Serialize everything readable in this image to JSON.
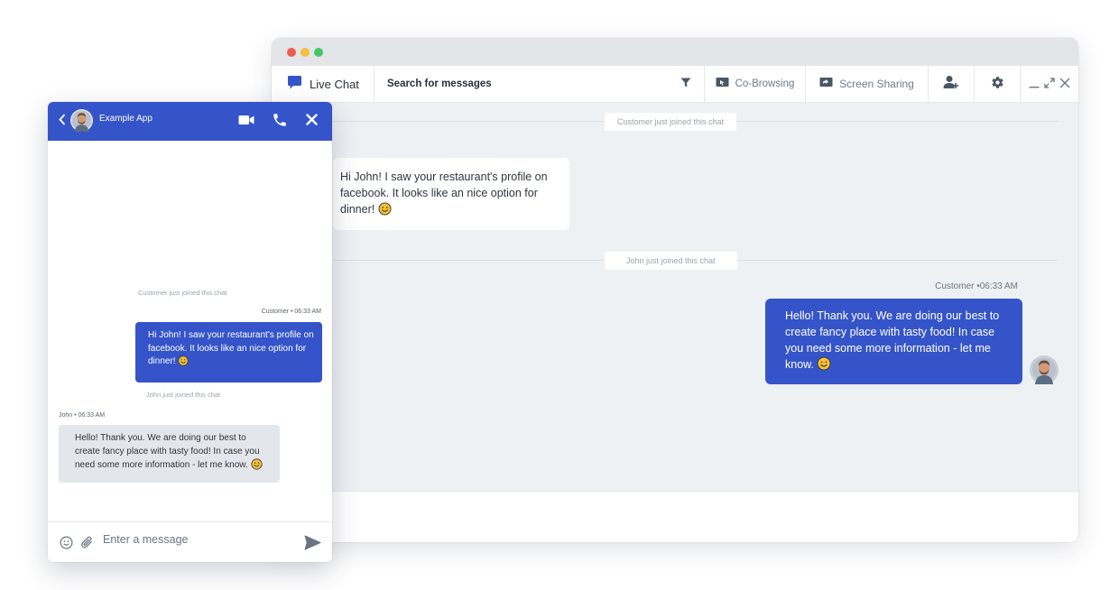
{
  "desktop": {
    "toolbar": {
      "live_chat": "Live Chat",
      "search_label": "Search for messages",
      "co_browsing": "Co-Browsing",
      "screen_sharing": "Screen Sharing"
    },
    "system_messages": [
      "Customer just joined this chat",
      "John just joined this chat"
    ],
    "incoming_message": "Hi John! I saw your restaurant's profile on facebook. It looks like an nice option for dinner!",
    "outgoing_meta": "Customer •06:33 AM",
    "outgoing_message": "Hello! Thank you. We are doing our best to create fancy place with tasty food! In case you need some more information - let me know."
  },
  "mobile": {
    "app_name": "Example App",
    "system_messages": [
      "Customer just joined this chat",
      "John just joined this chat"
    ],
    "customer_meta": "Customer • 06:33 AM",
    "customer_message": "Hi John! I saw your restaurant's profile on facebook. It looks like an nice option for dinner!",
    "john_meta": "John • 06:33 AM",
    "john_message": "Hello! Thank you. We are doing our best to create fancy place with tasty food! In case you need some more information - let me know.",
    "input_placeholder": "Enter a message"
  },
  "colors": {
    "brand_blue": "#3554c9",
    "background": "#eef1f4"
  },
  "icons": [
    "chat-bubble-icon",
    "filter-icon",
    "co-browsing-icon",
    "screen-sharing-icon",
    "add-user-icon",
    "gear-icon",
    "minimize-icon",
    "maximize-icon",
    "close-icon",
    "back-icon",
    "video-icon",
    "phone-icon",
    "emoji-icon",
    "attachment-icon",
    "send-icon"
  ]
}
